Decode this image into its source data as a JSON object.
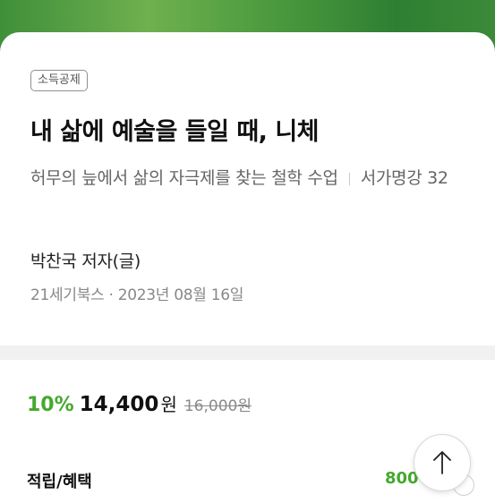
{
  "book": {
    "badge": "소득공제",
    "title": "내 삶에 예술을 들일 때, 니체",
    "subtitle_main": "허무의 늪에서 삶의 자극제를 찾는 철학 수업",
    "series": "서가명강 32",
    "author": "박찬국 저자(글)",
    "publisher": "21세기북스",
    "date": "2023년 08월 16일",
    "separator_dot": "·"
  },
  "price": {
    "discount": "10%",
    "sale": "14,400",
    "unit": "원",
    "original": "16,000원"
  },
  "benefits": {
    "label": "적립/혜택",
    "value": "800"
  },
  "colors": {
    "accent_green": "#44a92d"
  },
  "icons": {
    "scroll_top": "arrow-up-icon"
  }
}
